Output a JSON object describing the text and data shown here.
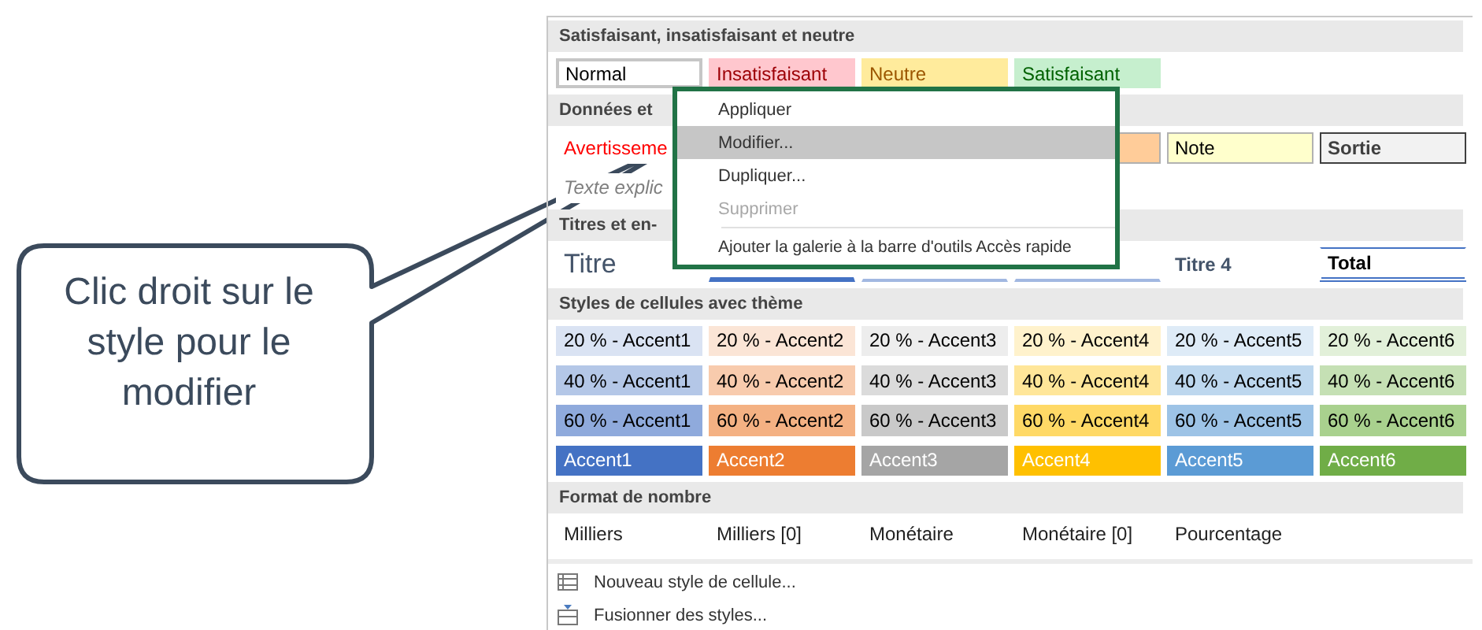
{
  "gallery": {
    "sections": [
      {
        "header": "Satisfaisant, insatisfaisant et neutre",
        "rows": [
          [
            {
              "text": "Normal",
              "kind": "normal"
            },
            {
              "text": "Insatisfaisant",
              "kind": "bad"
            },
            {
              "text": "Neutre",
              "kind": "neutral"
            },
            {
              "text": "Satisfaisant",
              "kind": "good"
            }
          ]
        ]
      },
      {
        "header": "Données et",
        "rows": [
          [
            {
              "text": "Avertisseme",
              "kind": "warning"
            },
            {
              "kind": "covered"
            },
            {
              "kind": "covered"
            },
            {
              "kind": "calculation"
            },
            {
              "text": "Note",
              "kind": "note"
            },
            {
              "text": "Sortie",
              "kind": "output"
            }
          ],
          [
            {
              "text": "Texte explic",
              "kind": "explanatory"
            }
          ]
        ]
      },
      {
        "header": "Titres et en-",
        "rows": [
          [
            {
              "text": "Titre",
              "kind": "title"
            },
            {
              "kind": "heading1"
            },
            {
              "kind": "heading2"
            },
            {
              "kind": "heading3"
            },
            {
              "text": "Titre 4",
              "kind": "heading4"
            },
            {
              "text": "Total",
              "kind": "total"
            }
          ]
        ]
      },
      {
        "header": "Styles de cellules avec thème",
        "rows": [
          [
            {
              "text": "20 % - Accent1",
              "kind": "tint",
              "color": "#dae3f3"
            },
            {
              "text": "20 % - Accent2",
              "kind": "tint",
              "color": "#fbe5d6"
            },
            {
              "text": "20 % - Accent3",
              "kind": "tint",
              "color": "#ededed"
            },
            {
              "text": "20 % - Accent4",
              "kind": "tint",
              "color": "#fff2cc"
            },
            {
              "text": "20 % - Accent5",
              "kind": "tint",
              "color": "#deebf7"
            },
            {
              "text": "20 % - Accent6",
              "kind": "tint",
              "color": "#e2f0d9"
            }
          ],
          [
            {
              "text": "40 % - Accent1",
              "kind": "tint",
              "color": "#b4c7e7"
            },
            {
              "text": "40 % - Accent2",
              "kind": "tint",
              "color": "#f8cbad"
            },
            {
              "text": "40 % - Accent3",
              "kind": "tint",
              "color": "#dbdbdb"
            },
            {
              "text": "40 % - Accent4",
              "kind": "tint",
              "color": "#ffe699"
            },
            {
              "text": "40 % - Accent5",
              "kind": "tint",
              "color": "#bdd7ee"
            },
            {
              "text": "40 % - Accent6",
              "kind": "tint",
              "color": "#c5e0b4"
            }
          ],
          [
            {
              "text": "60 % - Accent1",
              "kind": "tint",
              "color": "#8faadc"
            },
            {
              "text": "60 % - Accent2",
              "kind": "tint",
              "color": "#f4b183"
            },
            {
              "text": "60 % - Accent3",
              "kind": "tint",
              "color": "#c9c9c9"
            },
            {
              "text": "60 % - Accent4",
              "kind": "tint",
              "color": "#ffd966"
            },
            {
              "text": "60 % - Accent5",
              "kind": "tint",
              "color": "#9dc3e6"
            },
            {
              "text": "60 % - Accent6",
              "kind": "tint",
              "color": "#a9d18e"
            }
          ],
          [
            {
              "text": "Accent1",
              "kind": "accent",
              "color": "#4472c4"
            },
            {
              "text": "Accent2",
              "kind": "accent",
              "color": "#ed7d31"
            },
            {
              "text": "Accent3",
              "kind": "accent",
              "color": "#a5a5a5"
            },
            {
              "text": "Accent4",
              "kind": "accent",
              "color": "#ffc000"
            },
            {
              "text": "Accent5",
              "kind": "accent",
              "color": "#5b9bd5"
            },
            {
              "text": "Accent6",
              "kind": "accent",
              "color": "#70ad47"
            }
          ]
        ]
      },
      {
        "header": "Format de nombre",
        "rows": [
          [
            {
              "text": "Milliers",
              "kind": "number"
            },
            {
              "text": "Milliers [0]",
              "kind": "number"
            },
            {
              "text": "Monétaire",
              "kind": "number"
            },
            {
              "text": "Monétaire [0]",
              "kind": "number"
            },
            {
              "text": "Pourcentage",
              "kind": "number"
            }
          ]
        ]
      }
    ],
    "commands": [
      {
        "label": "Nouveau style de cellule...",
        "kind": "new"
      },
      {
        "label": "Fusionner des styles...",
        "kind": "merge"
      }
    ]
  },
  "context_menu": {
    "items": [
      {
        "label": "Appliquer",
        "selected": false,
        "disabled": false
      },
      {
        "label": "Modifier...",
        "selected": true,
        "disabled": false
      },
      {
        "label": "Dupliquer...",
        "selected": false,
        "disabled": false
      },
      {
        "label": "Supprimer",
        "selected": false,
        "disabled": true
      },
      {
        "label": "Ajouter la galerie à la barre d'outils Accès rapide",
        "selected": false,
        "disabled": false,
        "separator_before": true
      }
    ]
  },
  "callout": {
    "text": "Clic droit sur le style pour le modifier"
  }
}
